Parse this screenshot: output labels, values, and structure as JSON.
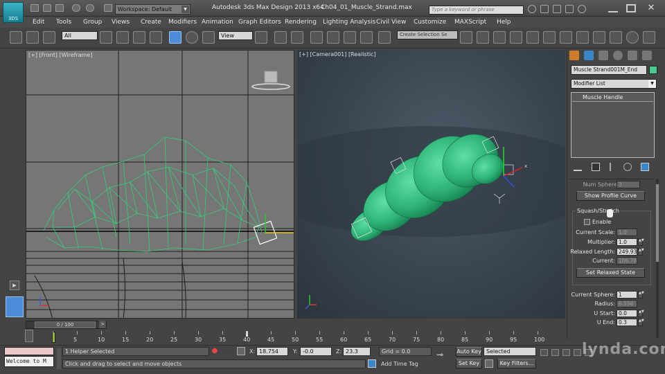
{
  "title_bar": {
    "logo_text": "3DS",
    "workspace": "Workspace: Default",
    "app_title": "Autodesk 3ds Max Design 2013 x64",
    "file_name": "Ch04_01_Muscle_Strand.max",
    "search_placeholder": "Type a keyword or phrase"
  },
  "menu": [
    "Edit",
    "Tools",
    "Group",
    "Views",
    "Create",
    "Modifiers",
    "Animation",
    "Graph Editors",
    "Rendering",
    "Lighting Analysis",
    "Civil View",
    "Customize",
    "MAXScript",
    "Help"
  ],
  "toolbar": {
    "selection_filter": "All",
    "reference_coord": "View",
    "named_selection": "Create Selection Se"
  },
  "viewports": {
    "front_label": "[+] [Front] [Wireframe]",
    "camera_label": "[+] [Camera001] [Realistic]"
  },
  "command_panel": {
    "object_name": "Muscle Strand001M_End",
    "object_color": "#4acb8f",
    "modifier_list": "Modifier List",
    "stack_items": [
      "Muscle Handle"
    ],
    "rollout": {
      "num_spheres_label": "Num Spheres:",
      "num_spheres_value": "3",
      "show_profile_curve": "Show Profile Curve",
      "squash_stretch_group": "Squash/Stretch",
      "enable_label": "Enable",
      "current_scale_label": "Current Scale:",
      "current_scale_value": "1.0",
      "multiplier_label": "Multiplier:",
      "multiplier_value": "1.0",
      "relaxed_length_label": "Relaxed Length:",
      "relaxed_length_value": "249.936",
      "current_label": "Current:",
      "current_value": "106.787",
      "set_relaxed_state": "Set Relaxed State",
      "current_sphere_label": "Current Sphere:",
      "current_sphere_value": "1",
      "radius_label": "Radius:",
      "radius_value": "6.556",
      "u_start_label": "U Start:",
      "u_start_value": "0.0",
      "u_end_label": "U End:",
      "u_end_value": "0.3"
    }
  },
  "timeline": {
    "slider_text": "0 / 100",
    "ticks": [
      "0",
      "5",
      "10",
      "15",
      "20",
      "25",
      "30",
      "35",
      "40",
      "45",
      "50",
      "55",
      "60",
      "65",
      "70",
      "75",
      "80",
      "85",
      "90",
      "95",
      "100"
    ]
  },
  "status": {
    "welcome": "Welcome to M",
    "selection": "1 Helper Selected",
    "prompt": "Click and drag to select and move objects",
    "x_label": "X:",
    "x_value": "18.754",
    "y_label": "Y:",
    "y_value": "-0.0",
    "z_label": "Z:",
    "z_value": "23.3",
    "grid": "Grid = 0.0",
    "add_time_tag": "Add Time Tag",
    "auto_key": "Auto Key",
    "auto_key_mode": "Selected",
    "set_key": "Set Key",
    "key_filters": "Key Filters..."
  },
  "watermark": "lynda.com"
}
